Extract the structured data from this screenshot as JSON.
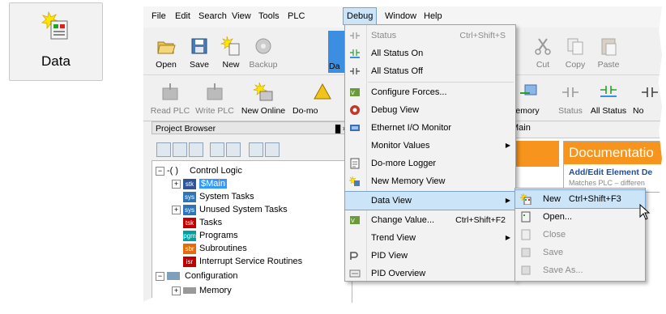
{
  "tile": {
    "label": "Data",
    "icon": "data-view-new-icon"
  },
  "menubar": {
    "items": [
      "File",
      "Edit",
      "Search",
      "View",
      "Tools",
      "PLC",
      "Debug",
      "Window",
      "Help"
    ],
    "active": "Debug"
  },
  "toolbar1": {
    "items": [
      {
        "label": "Open",
        "icon": "open-folder-icon"
      },
      {
        "label": "Save",
        "icon": "save-disk-icon"
      },
      {
        "label": "New",
        "icon": "new-project-icon"
      },
      {
        "label": "Backup",
        "icon": "backup-icon"
      },
      {
        "label": "Da",
        "icon": "data-icon"
      },
      {
        "label": "Cut",
        "icon": "cut-icon"
      },
      {
        "label": "Copy",
        "icon": "copy-icon"
      },
      {
        "label": "Paste",
        "icon": "paste-icon"
      }
    ]
  },
  "toolbar2": {
    "items": [
      {
        "label": "Read PLC",
        "icon": "read-plc-icon"
      },
      {
        "label": "Write PLC",
        "icon": "write-plc-icon"
      },
      {
        "label": "New Online",
        "icon": "new-online-icon"
      },
      {
        "label": "Do-mo",
        "icon": "do-more-icon"
      },
      {
        "label": "emory",
        "icon": "memory-icon"
      },
      {
        "label": "Status",
        "icon": "status-icon"
      },
      {
        "label": "All Status",
        "icon": "all-status-icon"
      },
      {
        "label": "No",
        "icon": "no-status-icon"
      }
    ]
  },
  "project_browser": {
    "title": "Project Browser",
    "pin": "█ ×",
    "tree": [
      {
        "label": "Control Logic",
        "prefix": "-( )",
        "expander": "−"
      },
      {
        "label": "$Main",
        "badge": "stk",
        "expander": "+"
      },
      {
        "label": "System Tasks",
        "badge": "sys"
      },
      {
        "label": "Unused System Tasks",
        "badge": "sys",
        "expander": "+"
      },
      {
        "label": "Tasks",
        "badge": "tsk"
      },
      {
        "label": "Programs",
        "badge": "pgm"
      },
      {
        "label": "Subroutines",
        "badge": "sbr"
      },
      {
        "label": "Interrupt Service Routines",
        "badge": "isr"
      },
      {
        "label": "Configuration",
        "expander": "−"
      },
      {
        "label": "Memory",
        "expander": "+"
      }
    ]
  },
  "editor": {
    "tab": "Main",
    "doc_title": "Documentatio",
    "doc_link": "Add/Edit Element De",
    "doc_sub": "Matches PLC – differen"
  },
  "debug_menu": {
    "items": [
      {
        "label": "Status",
        "shortcut": "Ctrl+Shift+S",
        "icon": "status-icon",
        "enabled": false
      },
      {
        "label": "All Status On",
        "icon": "all-status-on-icon",
        "enabled": true
      },
      {
        "label": "All Status Off",
        "icon": "all-status-off-icon",
        "enabled": true
      },
      {
        "label": "Configure Forces...",
        "icon": "configure-forces-icon",
        "enabled": true
      },
      {
        "label": "Debug View",
        "icon": "debug-view-icon",
        "enabled": true
      },
      {
        "label": "Ethernet I/O Monitor",
        "icon": "ethernet-monitor-icon",
        "enabled": true
      },
      {
        "label": "Monitor Values",
        "submenu": true,
        "enabled": true
      },
      {
        "label": "Do-more Logger",
        "icon": "logger-icon",
        "enabled": true
      },
      {
        "label": "New Memory View",
        "icon": "memory-view-icon",
        "enabled": true
      },
      {
        "label": "Data View",
        "submenu": true,
        "enabled": true,
        "highlighted": true
      },
      {
        "label": "Change Value...",
        "shortcut": "Ctrl+Shift+F2",
        "icon": "change-value-icon",
        "enabled": true
      },
      {
        "label": "Trend View",
        "submenu": true,
        "enabled": true
      },
      {
        "label": "PID View",
        "icon": "pid-view-icon",
        "enabled": true
      },
      {
        "label": "PID Overview",
        "icon": "pid-overview-icon",
        "enabled": true
      }
    ]
  },
  "dataview_submenu": {
    "items": [
      {
        "label": "New",
        "shortcut": "Ctrl+Shift+F3",
        "icon": "data-view-new-icon",
        "enabled": true,
        "highlighted": true
      },
      {
        "label": "Open...",
        "icon": "open-icon",
        "enabled": true
      },
      {
        "label": "Close",
        "icon": "close-doc-icon",
        "enabled": false
      },
      {
        "label": "Save",
        "icon": "save-icon",
        "enabled": false
      },
      {
        "label": "Save As...",
        "icon": "save-as-icon",
        "enabled": false
      }
    ]
  },
  "colors": {
    "highlight": "#cce4f7",
    "highlight_border": "#7da2ce",
    "orange": "#f7941d",
    "selection": "#3399ff"
  }
}
